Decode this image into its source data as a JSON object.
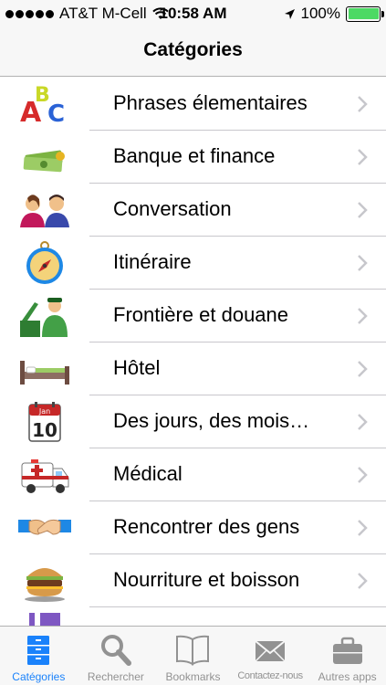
{
  "status": {
    "carrier": "AT&T M-Cell",
    "time": "10:58 AM",
    "battery": "100%"
  },
  "nav": {
    "title": "Catégories"
  },
  "categories": [
    {
      "label": "Phrases élementaires",
      "icon": "abc-blocks-icon"
    },
    {
      "label": "Banque et finance",
      "icon": "money-icon"
    },
    {
      "label": "Conversation",
      "icon": "people-icon"
    },
    {
      "label": "Itinéraire",
      "icon": "compass-icon"
    },
    {
      "label": "Frontière et douane",
      "icon": "customs-officer-icon"
    },
    {
      "label": "Hôtel",
      "icon": "bed-icon"
    },
    {
      "label": "Des jours, des mois…",
      "icon": "calendar-icon"
    },
    {
      "label": "Médical",
      "icon": "ambulance-icon"
    },
    {
      "label": "Rencontrer des gens",
      "icon": "handshake-icon"
    },
    {
      "label": "Nourriture et boisson",
      "icon": "burger-icon"
    }
  ],
  "calendar_icon_text": {
    "month": "Jan",
    "day": "10"
  },
  "tabs": [
    {
      "label": "Catégories",
      "icon": "categories-icon",
      "active": true
    },
    {
      "label": "Rechercher",
      "icon": "search-icon",
      "active": false
    },
    {
      "label": "Bookmarks",
      "icon": "book-icon",
      "active": false
    },
    {
      "label": "Contactez-nous",
      "icon": "envelope-icon",
      "active": false
    },
    {
      "label": "Autres apps",
      "icon": "briefcase-icon",
      "active": false
    }
  ],
  "colors": {
    "accent": "#1a82fb",
    "inactive": "#929292",
    "battery": "#4cd964"
  }
}
